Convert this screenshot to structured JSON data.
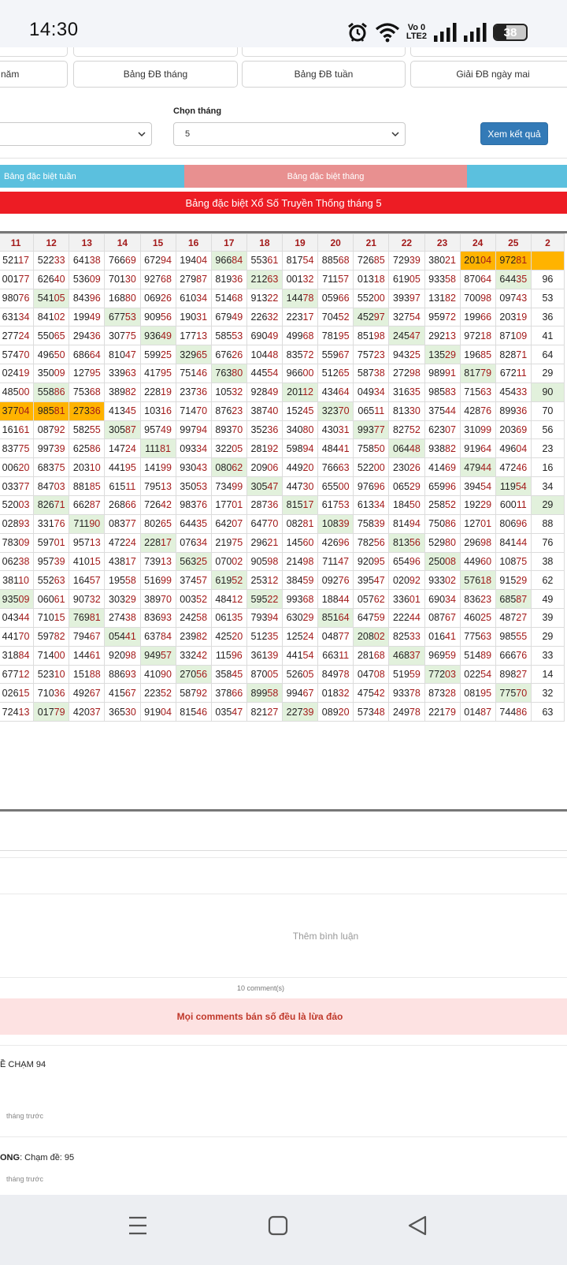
{
  "status_bar": {
    "time": "14:30",
    "lte_top": "Vo 0",
    "lte_bottom": "LTE2",
    "battery": "38"
  },
  "nav_buttons": [
    "năm",
    "Bảng ĐB tháng",
    "Bảng ĐB tuần",
    "Giải ĐB ngày mai"
  ],
  "month_label": "Chọn tháng",
  "month_value": "5",
  "view_button": "Xem kết quả",
  "tabs": {
    "week": "Bảng đặc biệt tuần",
    "month": "Bảng đặc biệt tháng"
  },
  "table_title": "Bảng đặc biệt Xổ Số Truyền Thống tháng 5",
  "table": {
    "headers": [
      "11",
      "12",
      "13",
      "14",
      "15",
      "16",
      "17",
      "18",
      "19",
      "20",
      "21",
      "22",
      "23",
      "24",
      "25",
      "2"
    ],
    "rows": [
      [
        "52117",
        "52233",
        "64138",
        "76669",
        "67294",
        "19404",
        "96684",
        "55361",
        "81754",
        "88568",
        "72685",
        "72939",
        "38021",
        "20104",
        "97281",
        ""
      ],
      [
        "00177",
        "62640",
        "53609",
        "70130",
        "92768",
        "27987",
        "81936",
        "21263",
        "00132",
        "71157",
        "01318",
        "61905",
        "93358",
        "87064",
        "64435",
        "96"
      ],
      [
        "98076",
        "54105",
        "84396",
        "16880",
        "06926",
        "61034",
        "51468",
        "91322",
        "14478",
        "05966",
        "55200",
        "39397",
        "13182",
        "70098",
        "09743",
        "53"
      ],
      [
        "63134",
        "84102",
        "19949",
        "67753",
        "90956",
        "19031",
        "67949",
        "22632",
        "22317",
        "70452",
        "45297",
        "32754",
        "95972",
        "19966",
        "20319",
        "36"
      ],
      [
        "27724",
        "55065",
        "29436",
        "30775",
        "93649",
        "17713",
        "58553",
        "69049",
        "49968",
        "78195",
        "85198",
        "24547",
        "29213",
        "97218",
        "87109",
        "41"
      ],
      [
        "57470",
        "49650",
        "68664",
        "81047",
        "59925",
        "32965",
        "67626",
        "10448",
        "83572",
        "55967",
        "75723",
        "94325",
        "13529",
        "19685",
        "82871",
        "64"
      ],
      [
        "02419",
        "35009",
        "12795",
        "33963",
        "41795",
        "75146",
        "76380",
        "44554",
        "96600",
        "51265",
        "58738",
        "27298",
        "98991",
        "81779",
        "67211",
        "29"
      ],
      [
        "48500",
        "55886",
        "75368",
        "38982",
        "22819",
        "23736",
        "10532",
        "92849",
        "20112",
        "43464",
        "04934",
        "31635",
        "98583",
        "71563",
        "45433",
        "90"
      ],
      [
        "37704",
        "98581",
        "27336",
        "41345",
        "10316",
        "71470",
        "87623",
        "38740",
        "15245",
        "32370",
        "06511",
        "81330",
        "37544",
        "42876",
        "89936",
        "70"
      ],
      [
        "16161",
        "08792",
        "58255",
        "30587",
        "95749",
        "99794",
        "89370",
        "35236",
        "34080",
        "43031",
        "99377",
        "82752",
        "62307",
        "31099",
        "20369",
        "56"
      ],
      [
        "83775",
        "99739",
        "62586",
        "14724",
        "11181",
        "09334",
        "32205",
        "28192",
        "59894",
        "48441",
        "75850",
        "06448",
        "93882",
        "91964",
        "49604",
        "23"
      ],
      [
        "00620",
        "68375",
        "20310",
        "44195",
        "14199",
        "93043",
        "08062",
        "20906",
        "44920",
        "76663",
        "52200",
        "23026",
        "41469",
        "47944",
        "47246",
        "16"
      ],
      [
        "03377",
        "84703",
        "88185",
        "61511",
        "79513",
        "35053",
        "73499",
        "30547",
        "44730",
        "65500",
        "97696",
        "06529",
        "65996",
        "39454",
        "11954",
        "34"
      ],
      [
        "52003",
        "82671",
        "66287",
        "26866",
        "72642",
        "98376",
        "17701",
        "28736",
        "81517",
        "61753",
        "61334",
        "18450",
        "25852",
        "19229",
        "60011",
        "29"
      ],
      [
        "02893",
        "33176",
        "71190",
        "08377",
        "80265",
        "64435",
        "64207",
        "64770",
        "08281",
        "10839",
        "75839",
        "81494",
        "75086",
        "12701",
        "80696",
        "88"
      ],
      [
        "78309",
        "59701",
        "95713",
        "47224",
        "22817",
        "07634",
        "21975",
        "29621",
        "14560",
        "42696",
        "78256",
        "81356",
        "52980",
        "29698",
        "84144",
        "76"
      ],
      [
        "06238",
        "95739",
        "41015",
        "43817",
        "73913",
        "56325",
        "07002",
        "90598",
        "21498",
        "71147",
        "92095",
        "65496",
        "25008",
        "44960",
        "10875",
        "38"
      ],
      [
        "38110",
        "55263",
        "16457",
        "19558",
        "51699",
        "37457",
        "61952",
        "25312",
        "38459",
        "09276",
        "39547",
        "02092",
        "93302",
        "57618",
        "91529",
        "62"
      ],
      [
        "93509",
        "06061",
        "90732",
        "30329",
        "38970",
        "00352",
        "48412",
        "59522",
        "99368",
        "18844",
        "05762",
        "33601",
        "69034",
        "83623",
        "68587",
        "49"
      ],
      [
        "04344",
        "71015",
        "76981",
        "27438",
        "83693",
        "24258",
        "06135",
        "79394",
        "63029",
        "85164",
        "64759",
        "22244",
        "08767",
        "46025",
        "48727",
        "39"
      ],
      [
        "44170",
        "59782",
        "79467",
        "05441",
        "63784",
        "23982",
        "42520",
        "51235",
        "12524",
        "04877",
        "20802",
        "82533",
        "01641",
        "77563",
        "98555",
        "29"
      ],
      [
        "31884",
        "71400",
        "14461",
        "92098",
        "94957",
        "33242",
        "11596",
        "36139",
        "44154",
        "66311",
        "28168",
        "46837",
        "96959",
        "51489",
        "66676",
        "33"
      ],
      [
        "67712",
        "52310",
        "15188",
        "88693",
        "41090",
        "27056",
        "35845",
        "87005",
        "52605",
        "84978",
        "04708",
        "51959",
        "77203",
        "02254",
        "89827",
        "14"
      ],
      [
        "02615",
        "71036",
        "49267",
        "41567",
        "22352",
        "58792",
        "37866",
        "89958",
        "99467",
        "01832",
        "47542",
        "93378",
        "87328",
        "08195",
        "77570",
        "32"
      ],
      [
        "72413",
        "01779",
        "42037",
        "36530",
        "91904",
        "81546",
        "03547",
        "82127",
        "22739",
        "08920",
        "57348",
        "24978",
        "22179",
        "01487",
        "74486",
        "63"
      ]
    ]
  },
  "add_comment": "Thêm bình luận",
  "comment_count": "10 comment(s)",
  "warning": "Mọi comments bán số đều là lừa đảo",
  "comments": [
    {
      "text": "Ề CHẠM 94",
      "time": "tháng trước"
    },
    {
      "name": "ONG",
      "text": ": Chạm đề: 95",
      "time": "tháng trước"
    }
  ]
}
